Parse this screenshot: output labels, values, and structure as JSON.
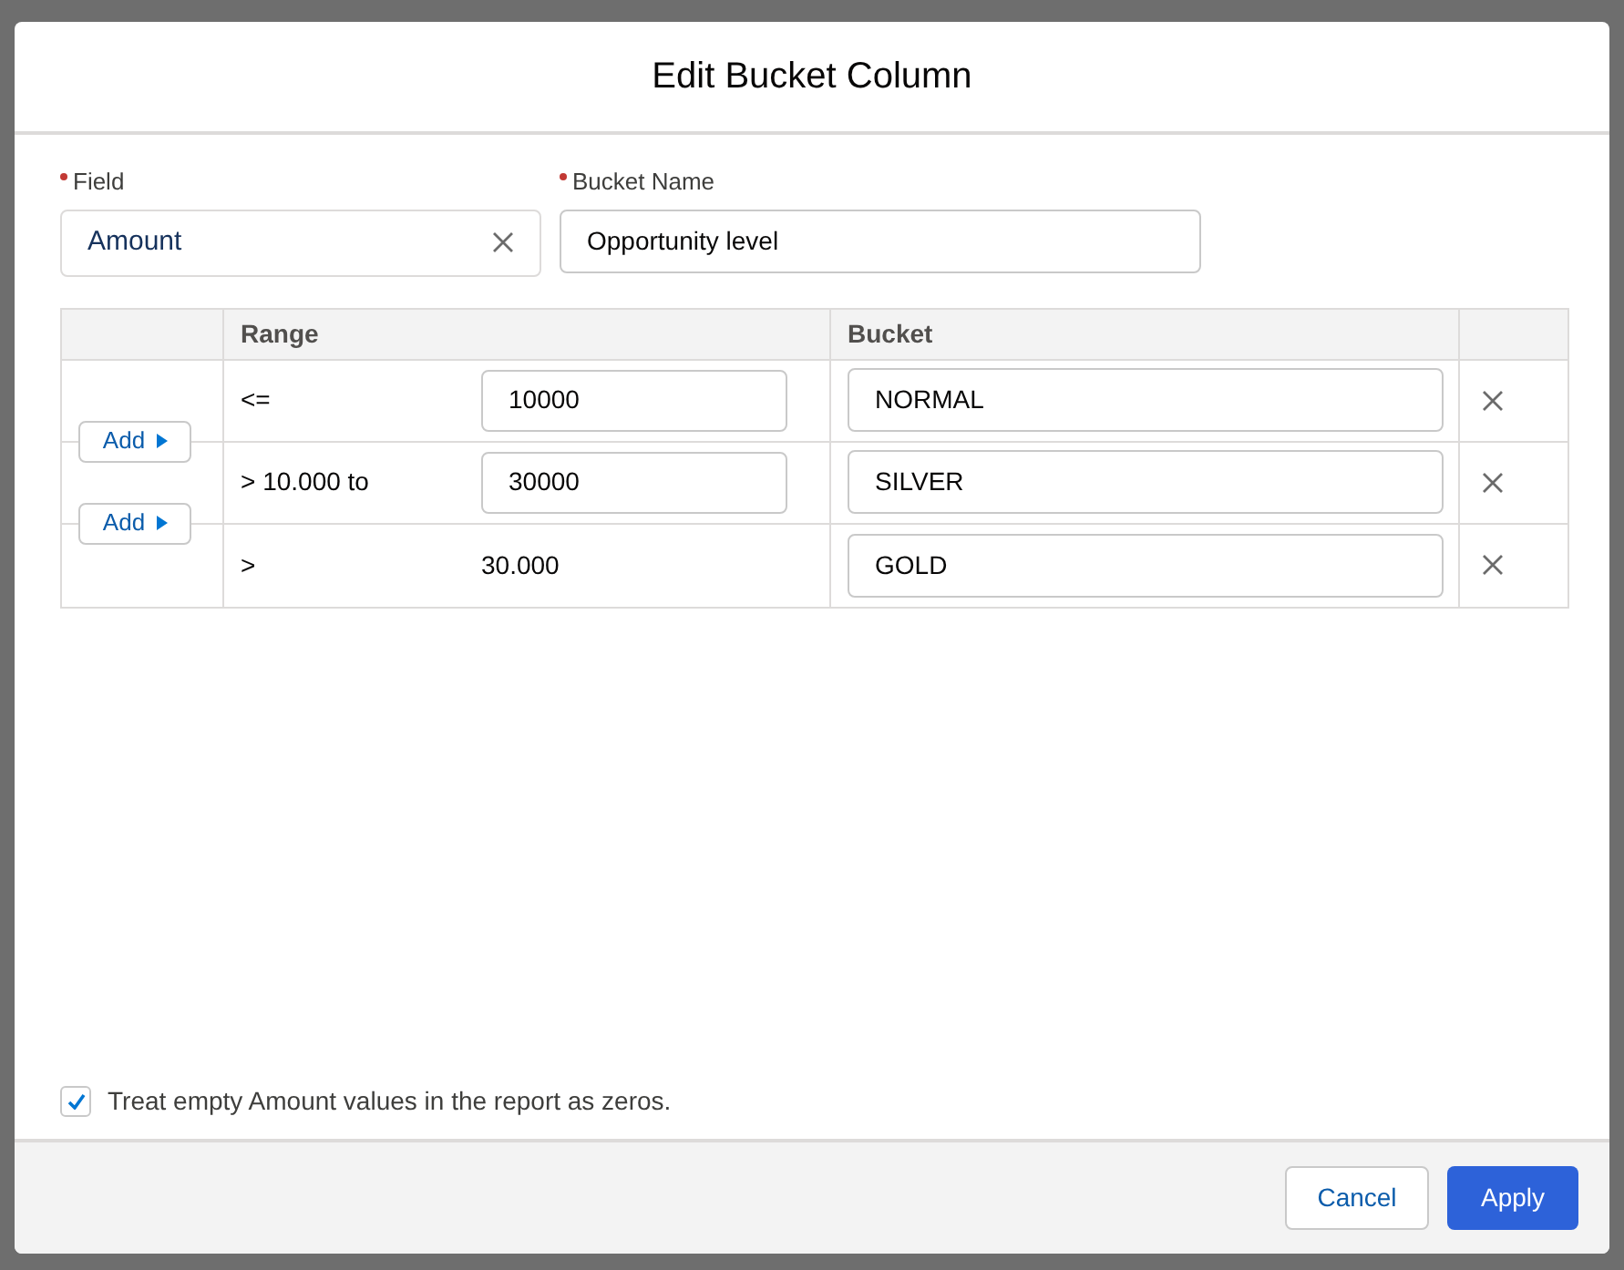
{
  "dialog": {
    "title": "Edit Bucket Column"
  },
  "field": {
    "label": "Field",
    "required": true,
    "value": "Amount"
  },
  "bucket_name": {
    "label": "Bucket Name",
    "required": true,
    "value": "Opportunity level"
  },
  "table": {
    "columns": [
      "Range",
      "Bucket"
    ],
    "rows": [
      {
        "kind": "input",
        "operator": "<=",
        "threshold": "10000",
        "bucket": "NORMAL",
        "add_button": "Add"
      },
      {
        "kind": "input",
        "operator": "> 10.000 to",
        "threshold": "30000",
        "bucket": "SILVER",
        "add_button": "Add"
      },
      {
        "kind": "text",
        "operator": ">",
        "threshold": "30.000",
        "bucket": "GOLD"
      }
    ]
  },
  "treat_empty": {
    "label": "Treat empty Amount values in the report as zeros.",
    "checked": true
  },
  "buttons": {
    "cancel": "Cancel",
    "apply": "Apply"
  }
}
